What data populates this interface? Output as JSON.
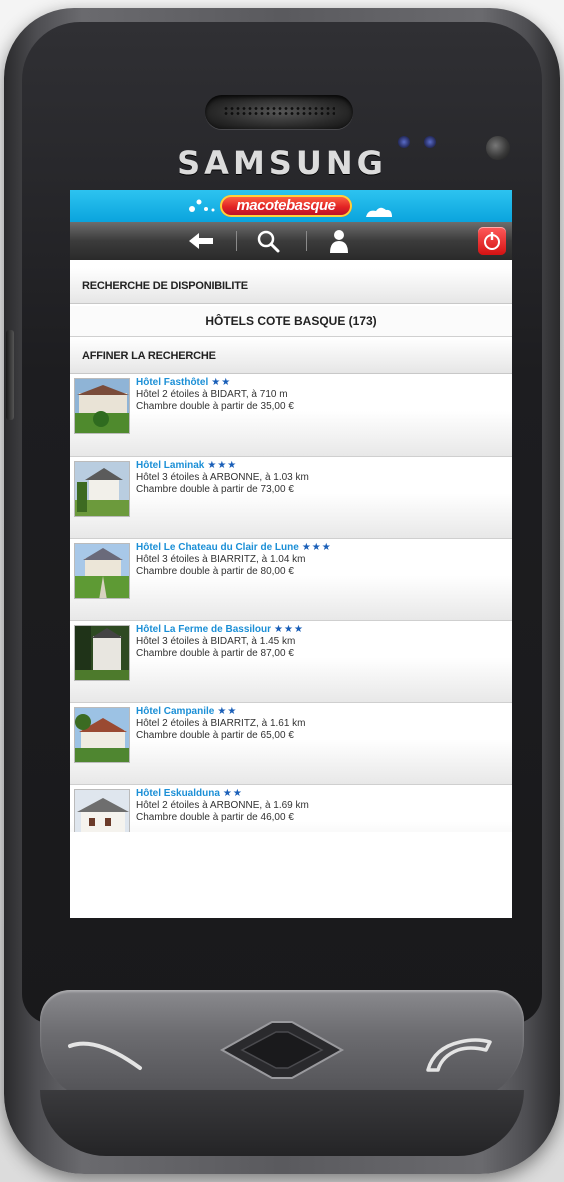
{
  "device": {
    "brand": "SAMSUNG"
  },
  "app": {
    "logo_text": "macotebasque",
    "toolbar": {
      "back_icon": "back-arrow-icon",
      "search_icon": "search-icon",
      "user_icon": "user-icon",
      "power_icon": "power-icon"
    },
    "section_search": "RECHERCHE DE DISPONIBILITE",
    "results_title": "HÔTELS COTE BASQUE (173)",
    "section_refine": "AFFINER LA RECHERCHE",
    "hotels": [
      {
        "name": "Hôtel Fasthôtel",
        "stars": "★★",
        "detail": "Hôtel 2 étoiles à BIDART, à 710 m",
        "price": "Chambre double à partir de 35,00 €"
      },
      {
        "name": "Hôtel Laminak",
        "stars": "★★★",
        "detail": "Hôtel 3 étoiles à ARBONNE, à 1.03 km",
        "price": "Chambre double à partir de 73,00 €"
      },
      {
        "name": "Hôtel Le Chateau du Clair de Lune",
        "stars": "★★★",
        "detail": "Hôtel 3 étoiles à BIARRITZ, à 1.04 km",
        "price": "Chambre double à partir de 80,00 €"
      },
      {
        "name": "Hôtel La Ferme de Bassilour",
        "stars": "★★★",
        "detail": "Hôtel 3 étoiles à BIDART, à 1.45 km",
        "price": "Chambre double à partir de 87,00 €"
      },
      {
        "name": "Hôtel Campanile",
        "stars": "★★",
        "detail": "Hôtel 2 étoiles à BIARRITZ, à 1.61 km",
        "price": "Chambre double à partir de 65,00 €"
      },
      {
        "name": "Hôtel Eskualduna",
        "stars": "★★",
        "detail": "Hôtel 2 étoiles à ARBONNE, à 1.69 km",
        "price": "Chambre double à partir de 46,00 €"
      }
    ]
  },
  "colors": {
    "header_blue": "#0aa4dd",
    "link_blue": "#1b8fd6",
    "star_blue": "#1a5fb8",
    "power_red": "#d41212"
  }
}
